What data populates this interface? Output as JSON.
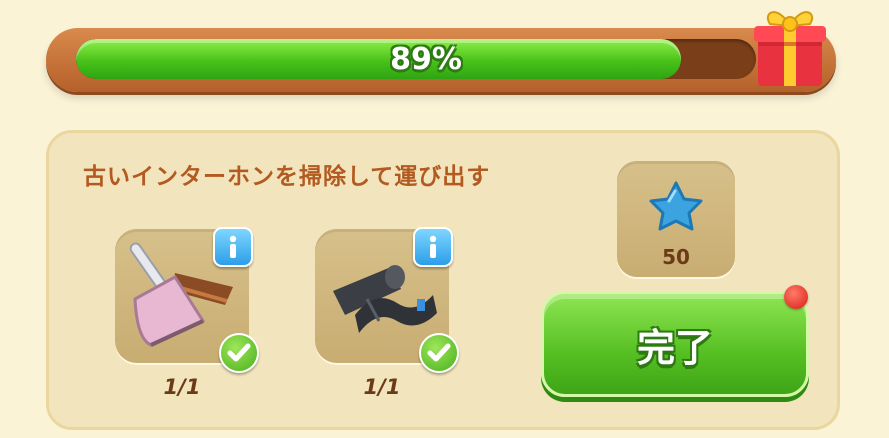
{
  "progress": {
    "percent_label": "89%",
    "value": 0.89,
    "fill_color": "#49c21a",
    "frame_color": "#b5602a"
  },
  "gift": {
    "icon": "gift-box-icon"
  },
  "task": {
    "title": "古いインターホンを掃除して運び出す",
    "items": [
      {
        "icon": "broom-dustpan-icon",
        "count": "1/1",
        "completed": true
      },
      {
        "icon": "garbage-bags-icon",
        "count": "1/1",
        "completed": true
      }
    ]
  },
  "reward": {
    "icon": "blue-star-icon",
    "value": "50",
    "color": "#3aa3e0"
  },
  "complete_button": {
    "label": "完了",
    "notification": true
  }
}
